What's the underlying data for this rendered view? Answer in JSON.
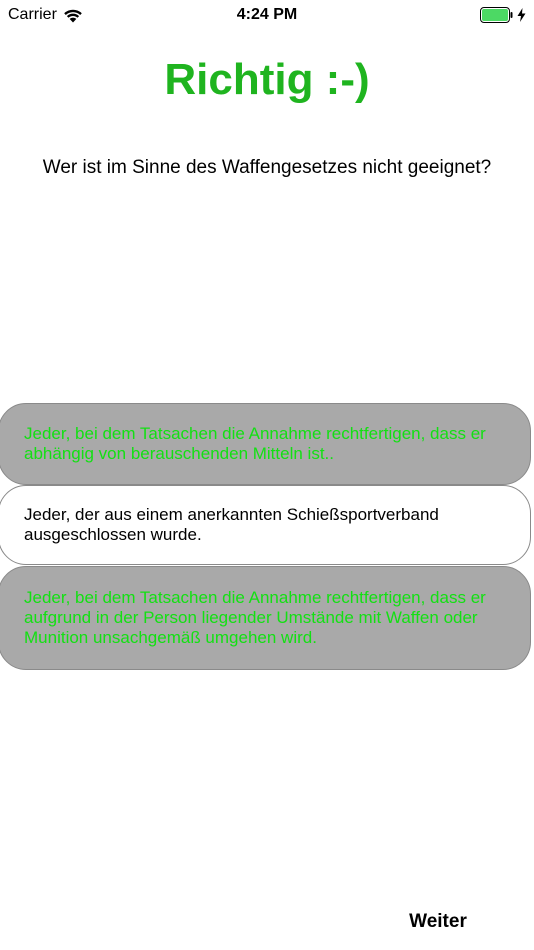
{
  "status_bar": {
    "carrier": "Carrier",
    "time": "4:24 PM",
    "icons": {
      "wifi": "wifi-icon",
      "battery": "battery-icon",
      "charging": "charging-bolt-icon"
    },
    "battery_color": "#4cd964"
  },
  "result": {
    "title": "Richtig :-)",
    "color": "#1fb41f"
  },
  "question": {
    "text": "Wer ist im Sinne des Waffengesetzes nicht geeignet?"
  },
  "answers": [
    {
      "text": "Jeder, bei dem Tatsachen die Annahme rechtfertigen, dass er abhängig von berauschenden Mitteln ist..",
      "state": "correct"
    },
    {
      "text": "Jeder, der aus einem anerkannten Schießsportverband ausgeschlossen wurde.",
      "state": "neutral"
    },
    {
      "text": "Jeder, bei dem Tatsachen die Annahme rechtfertigen, dass er aufgrund in der Person liegender Umstände mit Waffen oder Munition unsachgemäß umgehen wird.",
      "state": "correct"
    }
  ],
  "colors": {
    "correct_text": "#13e013",
    "correct_background": "#a9a9a9",
    "neutral_background": "#ffffff"
  },
  "footer": {
    "next_label": "Weiter"
  }
}
